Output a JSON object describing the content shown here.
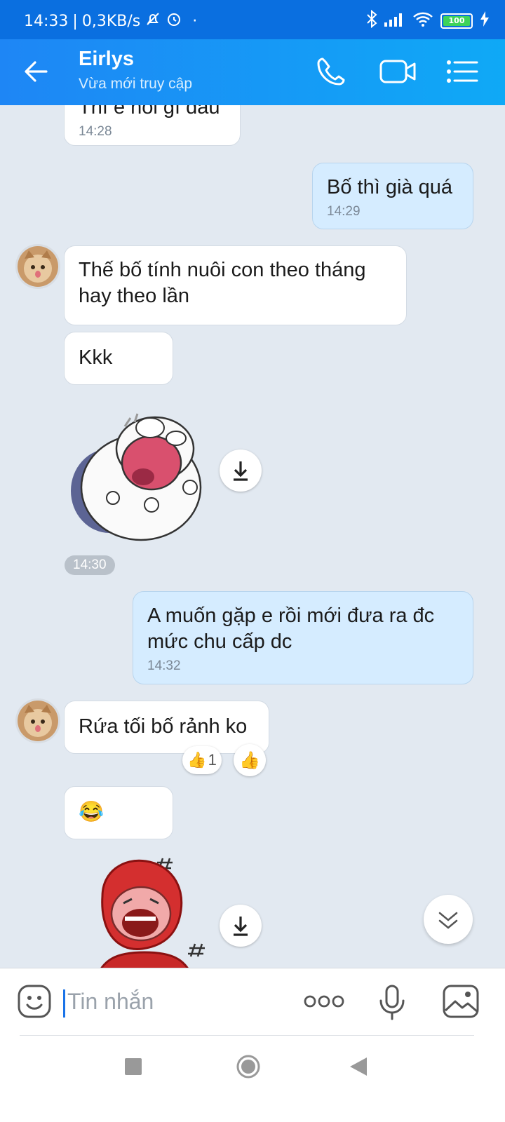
{
  "status_bar": {
    "time": "14:33",
    "separator": "|",
    "speed": "0,3KB/s",
    "dot": "·",
    "battery": "100"
  },
  "header": {
    "contact_name": "Eirlys",
    "contact_status": "Vừa mới truy cập"
  },
  "messages": [
    {
      "side": "them",
      "text": "Thì e nói gì đâu",
      "time": "14:28"
    },
    {
      "side": "me",
      "text": "Bố thì già quá",
      "time": "14:29"
    },
    {
      "side": "them",
      "text": "Thế bố tính nuôi con theo tháng hay theo lần"
    },
    {
      "side": "them",
      "text": "Kkk"
    },
    {
      "side": "them",
      "type": "sticker",
      "sticker": "white-cat-laughing-sticker",
      "time": "14:30"
    },
    {
      "side": "me",
      "text": "A muốn gặp e rồi mới đưa ra đc mức chu cấp dc",
      "time": "14:32"
    },
    {
      "side": "them",
      "text": "Rứa tối bố rảnh ko",
      "reaction_count": "1"
    },
    {
      "side": "them",
      "text": "😂"
    },
    {
      "side": "them",
      "type": "sticker",
      "sticker": "red-hood-laughing-sticker"
    }
  ],
  "input": {
    "placeholder": "Tin nhắn"
  },
  "colors": {
    "header_start": "#1e86f5",
    "header_end": "#0fa9f6",
    "my_bubble": "#d5ecff",
    "their_bubble": "#ffffff",
    "chat_bg": "#e2e9f1"
  },
  "icons": [
    "back-arrow-icon",
    "phone-icon",
    "video-call-icon",
    "menu-list-icon",
    "download-icon",
    "thumbs-up-icon",
    "scroll-down-icon",
    "emoji-icon",
    "more-icon",
    "microphone-icon",
    "image-icon",
    "recent-apps-icon",
    "home-icon",
    "back-nav-icon"
  ]
}
